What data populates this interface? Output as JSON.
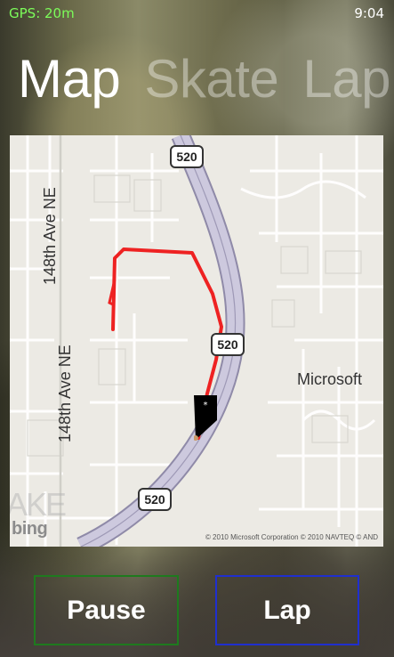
{
  "status": {
    "gps": "GPS: 20m",
    "time": "9:04"
  },
  "pivot": {
    "items": [
      "Map",
      "Skate",
      "Lap"
    ],
    "active": "Map"
  },
  "map": {
    "road_labels": {
      "left_top": "148th Ave NE",
      "left_bottom": "148th Ave NE"
    },
    "shields": [
      "520",
      "520",
      "520"
    ],
    "place_label": "Microsoft",
    "copyright": "© 2010 Microsoft Corporation  © 2010 NAVTEQ  © AND",
    "bing_logo": "bing",
    "watermark": "AKE",
    "colors": {
      "track": "#ee2222",
      "highway": "#c9c4da",
      "map_bg": "#eceae4"
    }
  },
  "buttons": {
    "pause": "Pause",
    "lap": "Lap"
  },
  "colors": {
    "gps_text": "#7CFC5A",
    "pause_border": "#1e7a1e",
    "lap_border": "#1f2fcf"
  }
}
